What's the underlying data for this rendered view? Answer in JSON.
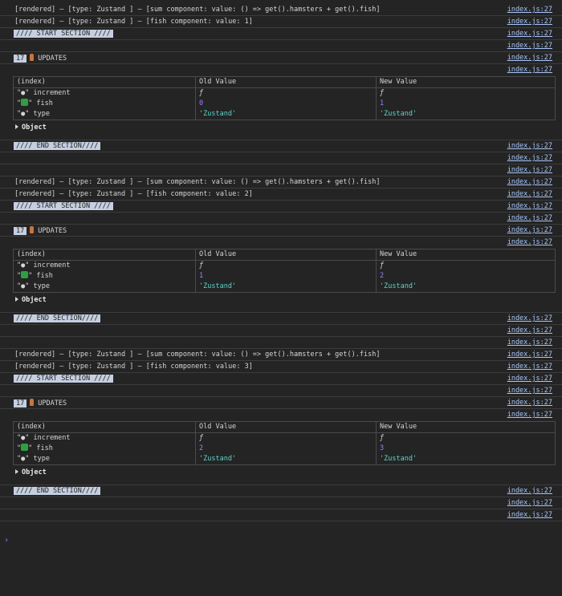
{
  "source_link": "index.js:27",
  "messages": {
    "render_sum": "[rendered] — [type: Zustand ] — [sum component: value: () => get().hamsters + get().fish]",
    "start_section": "//// START SECTION ////",
    "end_section": "//// END SECTION////",
    "updates_count": "17",
    "updates_label": "UPDATES",
    "object_label": "Object"
  },
  "table_headers": [
    "(index)",
    "Old Value",
    "New Value"
  ],
  "row_labels": {
    "increment": "\"●\" increment",
    "fish_prefix": "\"",
    "fish_suffix": "\" fish",
    "type": "\"●\" type"
  },
  "groups": [
    {
      "render_fish": "[rendered] — [type: Zustand ] — [fish component: value: 1]",
      "increment_old": "ƒ",
      "increment_new": "ƒ",
      "fish_old": "0",
      "fish_new": "1",
      "type_old": "'Zustand'",
      "type_new": "'Zustand'"
    },
    {
      "render_fish": "[rendered] — [type: Zustand ] — [fish component: value: 2]",
      "increment_old": "ƒ",
      "increment_new": "ƒ",
      "fish_old": "1",
      "fish_new": "2",
      "type_old": "'Zustand'",
      "type_new": "'Zustand'"
    },
    {
      "render_fish": "[rendered] — [type: Zustand ] — [fish component: value: 3]",
      "increment_old": "ƒ",
      "increment_new": "ƒ",
      "fish_old": "2",
      "fish_new": "3",
      "type_old": "'Zustand'",
      "type_new": "'Zustand'"
    }
  ],
  "prompt_glyph": "›"
}
